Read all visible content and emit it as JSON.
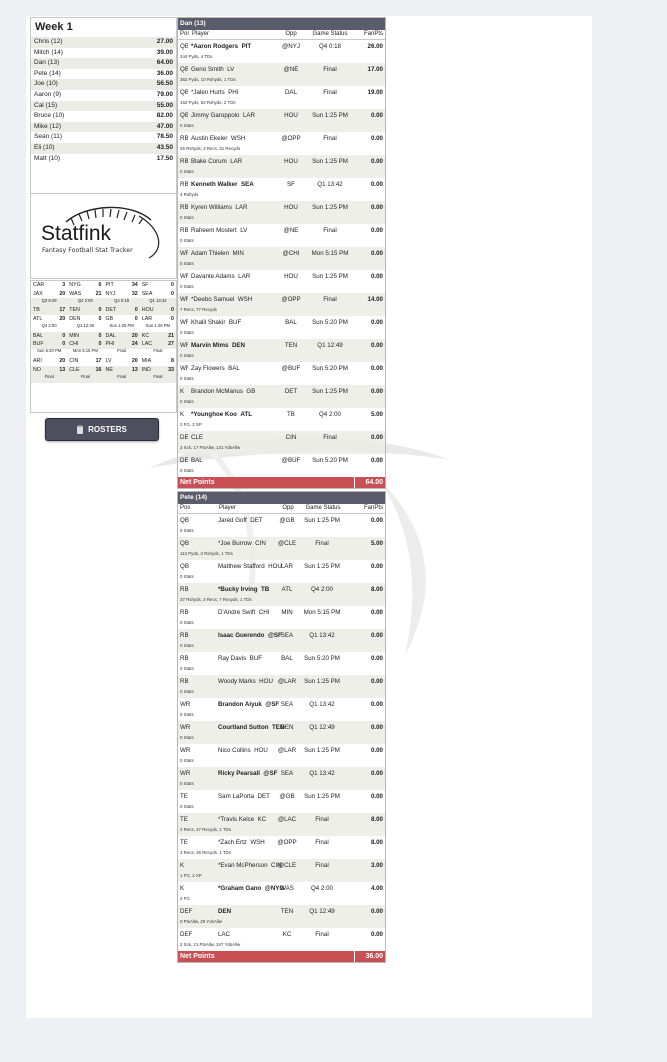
{
  "league": {
    "week_label": "Week 1",
    "standings": [
      {
        "name": "Chris (12)",
        "score": "27.00"
      },
      {
        "name": "Mitch (14)",
        "score": "39.00"
      },
      {
        "name": "Dan (13)",
        "score": "64.00"
      },
      {
        "name": "Pete (14)",
        "score": "36.00"
      },
      {
        "name": "Joe (10)",
        "score": "56.50"
      },
      {
        "name": "Aaron (9)",
        "score": "79.00"
      },
      {
        "name": "Cal (15)",
        "score": "55.00"
      },
      {
        "name": "Bruce (10)",
        "score": "82.00"
      },
      {
        "name": "Mike (12)",
        "score": "47.00"
      },
      {
        "name": "Sean (11)",
        "score": "78.50"
      },
      {
        "name": "Eli (10)",
        "score": "43.50"
      },
      {
        "name": "Matt (10)",
        "score": "17.50"
      }
    ]
  },
  "logo": {
    "word": "Statfink",
    "tagline": "Fantasy Football Stat Tracker"
  },
  "scoreboard": {
    "rows": [
      [
        {
          "t": "CAR",
          "p": "3"
        },
        {
          "t": "NYG",
          "p": "6"
        },
        {
          "t": "PIT",
          "p": "34"
        },
        {
          "t": "SF",
          "p": "0"
        }
      ],
      [
        {
          "t": "JAX",
          "p": "20"
        },
        {
          "t": "WAS",
          "p": "21"
        },
        {
          "t": "NYJ",
          "p": "32"
        },
        {
          "t": "SEA",
          "p": "0"
        }
      ],
      [
        {
          "s": "Q3 8:49"
        },
        {
          "s": "Q4 2:00"
        },
        {
          "s": "Q4 0:18"
        },
        {
          "s": "Q1 13:42"
        }
      ],
      [
        {
          "t": "TB",
          "p": "17"
        },
        {
          "t": "TEN",
          "p": "0"
        },
        {
          "t": "DET",
          "p": "0"
        },
        {
          "t": "HOU",
          "p": "0"
        }
      ],
      [
        {
          "t": "ATL",
          "p": "20"
        },
        {
          "t": "DEN",
          "p": "0"
        },
        {
          "t": "GB",
          "p": "0"
        },
        {
          "t": "LAR",
          "p": "0"
        }
      ],
      [
        {
          "s": "Q4 2:00"
        },
        {
          "s": "Q1 12:49"
        },
        {
          "s": "Sun 1:25 PM"
        },
        {
          "s": "Sun 1:25 PM"
        }
      ],
      [
        {
          "t": "BAL",
          "p": "0"
        },
        {
          "t": "MIN",
          "p": "0"
        },
        {
          "t": "DAL",
          "p": "20"
        },
        {
          "t": "KC",
          "p": "21"
        }
      ],
      [
        {
          "t": "BUF",
          "p": "0"
        },
        {
          "t": "CHI",
          "p": "0"
        },
        {
          "t": "PHI",
          "p": "24"
        },
        {
          "t": "LAC",
          "p": "27"
        }
      ],
      [
        {
          "s": "Sun 5:20 PM"
        },
        {
          "s": "Mon 5:15 PM"
        },
        {
          "s": "Final"
        },
        {
          "s": "Final"
        }
      ],
      [
        {
          "t": "ARI",
          "p": "20"
        },
        {
          "t": "CIN",
          "p": "17"
        },
        {
          "t": "LV",
          "p": "20"
        },
        {
          "t": "MIA",
          "p": "8"
        }
      ],
      [
        {
          "t": "NO",
          "p": "13"
        },
        {
          "t": "CLE",
          "p": "16"
        },
        {
          "t": "NE",
          "p": "13"
        },
        {
          "t": "IND",
          "p": "33"
        }
      ],
      [
        {
          "s": "Final"
        },
        {
          "s": "Final"
        },
        {
          "s": "Final"
        },
        {
          "s": "Final"
        }
      ]
    ]
  },
  "rosters_button": {
    "label": "ROSTERS",
    "icon": "clipboard-icon"
  },
  "teams": [
    {
      "title": "Dan (13)",
      "headers": {
        "pos": "Pos",
        "player": "Player",
        "opp": "Opp",
        "status": "Game Status",
        "pts": "FanPts"
      },
      "rows": [
        {
          "pos": "QB",
          "player": "*Aaron Rodgers",
          "nfl": "PIT",
          "opp": "@NYJ",
          "status": "Q4 0:18",
          "pts": "26.00",
          "detail": "244 Pyds, 4 TDs",
          "bold": true
        },
        {
          "pos": "QB",
          "player": "Geno Smith",
          "nfl": "LV",
          "opp": "@NE",
          "status": "Final",
          "pts": "17.00",
          "detail": "362 Pyds, 10 Rshyds, 1 TDs"
        },
        {
          "pos": "QB",
          "player": "*Jalen Hurts",
          "nfl": "PHI",
          "opp": "DAL",
          "status": "Final",
          "pts": "19.00",
          "detail": "152 Pyds, 62 Rshyds, 2 TDs"
        },
        {
          "pos": "QB",
          "player": "Jimmy Garoppolo",
          "nfl": "LAR",
          "opp": "HOU",
          "status": "Sun 1:25 PM",
          "pts": "0.00",
          "detail": "0 Stats"
        },
        {
          "pos": "RB",
          "player": "Austin Ekeler",
          "nfl": "WSH",
          "opp": "@OPP",
          "status": "Final",
          "pts": "0.00",
          "detail": "26 Rshyds, 3 Recs, 31 Recyds"
        },
        {
          "pos": "RB",
          "player": "Blake Corum",
          "nfl": "LAR",
          "opp": "HOU",
          "status": "Sun 1:25 PM",
          "pts": "0.00",
          "detail": "0 Stats"
        },
        {
          "pos": "RB",
          "player": "Kenneth Walker",
          "nfl": "SEA",
          "opp": "SF",
          "status": "Q1 13:42",
          "pts": "0.00",
          "detail": "4 Rshyds",
          "bold": true
        },
        {
          "pos": "RB",
          "player": "Kyren Williams",
          "nfl": "LAR",
          "opp": "HOU",
          "status": "Sun 1:25 PM",
          "pts": "0.00",
          "detail": "0 Stats"
        },
        {
          "pos": "RB",
          "player": "Raheem Mostert",
          "nfl": "LV",
          "opp": "@NE",
          "status": "Final",
          "pts": "0.00",
          "detail": "0 Stats"
        },
        {
          "pos": "WR",
          "player": "Adam Thielen",
          "nfl": "MIN",
          "opp": "@CHI",
          "status": "Mon 5:15 PM",
          "pts": "0.00",
          "detail": "0 Stats"
        },
        {
          "pos": "WR",
          "player": "Davante Adams",
          "nfl": "LAR",
          "opp": "HOU",
          "status": "Sun 1:25 PM",
          "pts": "0.00",
          "detail": "0 Stats"
        },
        {
          "pos": "WR",
          "player": "*Deebo Samuel",
          "nfl": "WSH",
          "opp": "@OPP",
          "status": "Final",
          "pts": "14.00",
          "detail": "7 Recs, 77 Recyds"
        },
        {
          "pos": "WR",
          "player": "Khalil Shakir",
          "nfl": "BUF",
          "opp": "BAL",
          "status": "Sun 5:20 PM",
          "pts": "0.00",
          "detail": "0 Stats"
        },
        {
          "pos": "WR",
          "player": "Marvin Mims",
          "nfl": "DEN",
          "opp": "TEN",
          "status": "Q1 12:49",
          "pts": "0.00",
          "detail": "0 Stats",
          "bold": true
        },
        {
          "pos": "WR",
          "player": "Zay Flowers",
          "nfl": "BAL",
          "opp": "@BUF",
          "status": "Sun 5:20 PM",
          "pts": "0.00",
          "detail": "0 Stats"
        },
        {
          "pos": "K",
          "player": "Brandon McManus",
          "nfl": "GB",
          "opp": "DET",
          "status": "Sun 1:25 PM",
          "pts": "0.00",
          "detail": "0 Stats"
        },
        {
          "pos": "K",
          "player": "*Younghoe Koo",
          "nfl": "ATL",
          "opp": "TB",
          "status": "Q4 2:00",
          "pts": "5.00",
          "detail": "2 FG, 2 XP",
          "bold": true
        },
        {
          "pos": "DEF",
          "player": "CLE",
          "nfl": "",
          "opp": "CIN",
          "status": "Final",
          "pts": "0.00",
          "detail": "3 Sck, 17 PtsAllw, 141 YdsAllw"
        },
        {
          "pos": "DEF",
          "player": "BAL",
          "nfl": "",
          "opp": "@BUF",
          "status": "Sun 5:20 PM",
          "pts": "0.00",
          "detail": "0 Stats"
        }
      ],
      "total_label": "Net Points",
      "total": "64.00"
    },
    {
      "title": "Pete (14)",
      "headers": {
        "pos": "Pos",
        "player": "Player",
        "opp": "Opp",
        "status": "Game Status",
        "pts": "FanPts"
      },
      "rows": [
        {
          "pos": "QB",
          "player": "Jared Goff",
          "nfl": "DET",
          "opp": "@GB",
          "status": "Sun 1:25 PM",
          "pts": "0.00",
          "detail": "0 Stats"
        },
        {
          "pos": "QB",
          "player": "*Joe Burrow",
          "nfl": "CIN",
          "opp": "@CLE",
          "status": "Final",
          "pts": "5.00",
          "detail": "113 Pyds, 3 Rshyds, 1 TDs"
        },
        {
          "pos": "QB",
          "player": "Matthew Stafford",
          "nfl": "HOU",
          "opp": "LAR",
          "status": "Sun 1:25 PM",
          "pts": "0.00",
          "detail": "0 Stats"
        },
        {
          "pos": "RB",
          "player": "*Bucky Irving",
          "nfl": "TB",
          "opp": "ATL",
          "status": "Q4 2:00",
          "pts": "8.00",
          "detail": "37 Rshyds, 3 Recs, 7 Recyds, 1 TDs",
          "bold": true
        },
        {
          "pos": "RB",
          "player": "D'Andre Swift",
          "nfl": "CHI",
          "opp": "MIN",
          "status": "Mon 5:15 PM",
          "pts": "0.00",
          "detail": "0 Stats"
        },
        {
          "pos": "RB",
          "player": "Isaac Guerendo",
          "nfl": "@SF",
          "opp": "SEA",
          "status": "Q1 13:42",
          "pts": "0.00",
          "detail": "0 Stats",
          "bold": true
        },
        {
          "pos": "RB",
          "player": "Ray Davis",
          "nfl": "BUF",
          "opp": "BAL",
          "status": "Sun 5:20 PM",
          "pts": "0.00",
          "detail": "0 Stats"
        },
        {
          "pos": "RB",
          "player": "Woody Marks",
          "nfl": "HOU",
          "opp": "@LAR",
          "status": "Sun 1:25 PM",
          "pts": "0.00",
          "detail": "0 Stats"
        },
        {
          "pos": "WR",
          "player": "Brandon Aiyuk",
          "nfl": "@SF",
          "opp": "SEA",
          "status": "Q1 13:42",
          "pts": "0.00",
          "detail": "0 Stats",
          "bold": true
        },
        {
          "pos": "WR",
          "player": "Courtland Sutton",
          "nfl": "TEN",
          "opp": "DEN",
          "status": "Q1 12:49",
          "pts": "0.00",
          "detail": "0 Stats",
          "bold": true
        },
        {
          "pos": "WR",
          "player": "Nico Collins",
          "nfl": "HOU",
          "opp": "@LAR",
          "status": "Sun 1:25 PM",
          "pts": "0.00",
          "detail": "0 Stats"
        },
        {
          "pos": "WR",
          "player": "Ricky Pearsall",
          "nfl": "@SF",
          "opp": "SEA",
          "status": "Q1 13:42",
          "pts": "0.00",
          "detail": "0 Stats",
          "bold": true
        },
        {
          "pos": "TE",
          "player": "Sam LaPorta",
          "nfl": "DET",
          "opp": "@GB",
          "status": "Sun 1:25 PM",
          "pts": "0.00",
          "detail": "0 Stats"
        },
        {
          "pos": "TE",
          "player": "*Travis Kelce",
          "nfl": "KC",
          "opp": "@LAC",
          "status": "Final",
          "pts": "8.00",
          "detail": "2 Recs, 47 Recyds, 1 TDs"
        },
        {
          "pos": "TE",
          "player": "*Zach Ertz",
          "nfl": "WSH",
          "opp": "@OPP",
          "status": "Final",
          "pts": "8.00",
          "detail": "3 Recs, 26 Recyds, 1 TDs"
        },
        {
          "pos": "K",
          "player": "*Evan McPherson",
          "nfl": "CIN",
          "opp": "@CLE",
          "status": "Final",
          "pts": "3.00",
          "detail": "1 FG, 2 XP"
        },
        {
          "pos": "K",
          "player": "*Graham Gano",
          "nfl": "@NYG",
          "opp": "WAS",
          "status": "Q4 2:00",
          "pts": "4.00",
          "detail": "2 FG",
          "bold": true
        },
        {
          "pos": "DEF",
          "player": "DEN",
          "nfl": "",
          "opp": "TEN",
          "status": "Q1 12:49",
          "pts": "0.00",
          "detail": "0 PtsAllw, 29 YdsAllw",
          "bold": true
        },
        {
          "pos": "DEF",
          "player": "LAC",
          "nfl": "",
          "opp": "KC",
          "status": "Final",
          "pts": "0.00",
          "detail": "2 Sck, 21 PtsAllw, 347 YdsAllw"
        }
      ],
      "total_label": "Net Points",
      "total": "36.00"
    }
  ],
  "colors": {
    "header": "#5b5c6b",
    "total": "#c84f53",
    "stripe": "#ecece6",
    "button": "#4e4e5f"
  }
}
